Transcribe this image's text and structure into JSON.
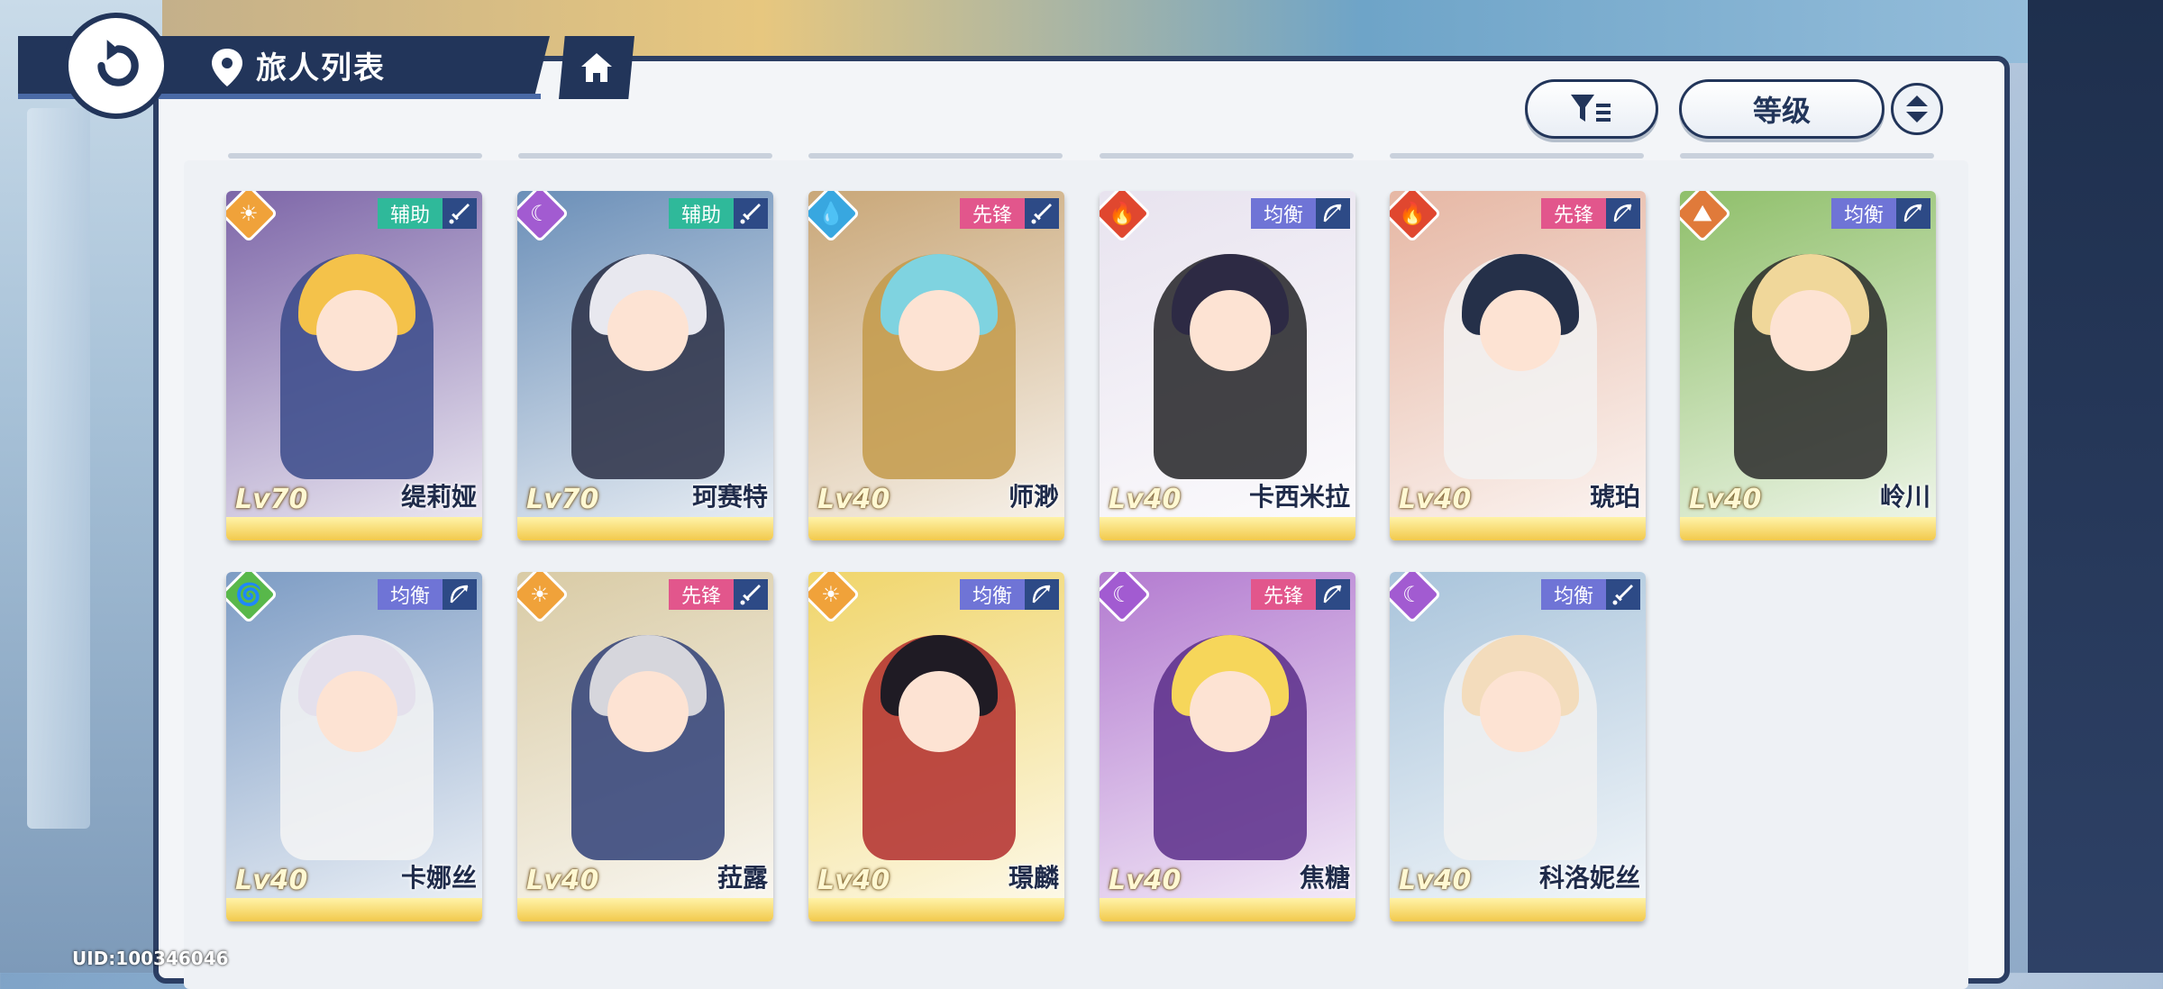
{
  "header": {
    "title": "旅人列表"
  },
  "controls": {
    "sort_label": "等级"
  },
  "footer": {
    "uid": "UID:100346046"
  },
  "colors": {
    "role_support": "#2fb99a",
    "role_vanguard": "#e2568c",
    "role_balanced": "#6f74d6",
    "element_light": "#f0a23a",
    "element_dark": "#a25bd1",
    "element_water": "#38a7e0",
    "element_fire": "#e0472f",
    "element_earth": "#e07a3a",
    "element_wind": "#58b84a"
  },
  "cards": [
    {
      "name": "缇莉娅",
      "level": "Lv70",
      "role": "辅助",
      "role_color": "#2fb99a",
      "element": "light",
      "element_color": "#f0a23a",
      "element_glyph": "☀",
      "weapon": "sword",
      "bg": "#7d66a8",
      "hair": "#f4c24a",
      "outfit": "#3a4a8a"
    },
    {
      "name": "珂赛特",
      "level": "Lv70",
      "role": "辅助",
      "role_color": "#2fb99a",
      "element": "dark",
      "element_color": "#a25bd1",
      "element_glyph": "☾",
      "weapon": "sword",
      "bg": "#6b8fb8",
      "hair": "#e8e8ef",
      "outfit": "#2a2f45"
    },
    {
      "name": "师渺",
      "level": "Lv40",
      "role": "先锋",
      "role_color": "#e2568c",
      "element": "water",
      "element_color": "#38a7e0",
      "element_glyph": "💧",
      "weapon": "sword",
      "bg": "#c9a778",
      "hair": "#7fd3e0",
      "outfit": "#c39a4a"
    },
    {
      "name": "卡西米拉",
      "level": "Lv40",
      "role": "均衡",
      "role_color": "#6f74d6",
      "element": "fire",
      "element_color": "#e0472f",
      "element_glyph": "🔥",
      "weapon": "bow",
      "bg": "#e8e3ef",
      "hair": "#2d2a44",
      "outfit": "#222226"
    },
    {
      "name": "琥珀",
      "level": "Lv40",
      "role": "先锋",
      "role_color": "#e2568c",
      "element": "fire",
      "element_color": "#e0472f",
      "element_glyph": "🔥",
      "weapon": "bow",
      "bg": "#e6b7a4",
      "hair": "#253049",
      "outfit": "#f2f2f2"
    },
    {
      "name": "岭川",
      "level": "Lv40",
      "role": "均衡",
      "role_color": "#6f74d6",
      "element": "earth",
      "element_color": "#e07a3a",
      "element_glyph": "⛰",
      "weapon": "bow",
      "bg": "#8fbf6a",
      "hair": "#f0d79a",
      "outfit": "#2a2a2a"
    },
    {
      "name": "卡娜丝",
      "level": "Lv40",
      "role": "均衡",
      "role_color": "#6f74d6",
      "element": "wind",
      "element_color": "#58b84a",
      "element_glyph": "🌀",
      "weapon": "bow",
      "bg": "#7d9cc4",
      "hair": "#e4e0ec",
      "outfit": "#f4f4f4"
    },
    {
      "name": "菈露",
      "level": "Lv40",
      "role": "先锋",
      "role_color": "#e2568c",
      "element": "light",
      "element_color": "#f0a23a",
      "element_glyph": "☀",
      "weapon": "sword",
      "bg": "#d9cba5",
      "hair": "#d6d6dc",
      "outfit": "#2f3f78"
    },
    {
      "name": "璟麟",
      "level": "Lv40",
      "role": "均衡",
      "role_color": "#6f74d6",
      "element": "light",
      "element_color": "#f0a23a",
      "element_glyph": "☀",
      "weapon": "bow",
      "bg": "#f0d56a",
      "hair": "#1f1b24",
      "outfit": "#b22d2d"
    },
    {
      "name": "焦糖",
      "level": "Lv40",
      "role": "先锋",
      "role_color": "#e2568c",
      "element": "dark",
      "element_color": "#a25bd1",
      "element_glyph": "☾",
      "weapon": "bow",
      "bg": "#b37bd0",
      "hair": "#f6d65a",
      "outfit": "#5a2e8a"
    },
    {
      "name": "科洛妮丝",
      "level": "Lv40",
      "role": "均衡",
      "role_color": "#6f74d6",
      "element": "dark",
      "element_color": "#a25bd1",
      "element_glyph": "☾",
      "weapon": "sword",
      "bg": "#a9c4db",
      "hair": "#f3dcbc",
      "outfit": "#f1f1f1"
    }
  ]
}
